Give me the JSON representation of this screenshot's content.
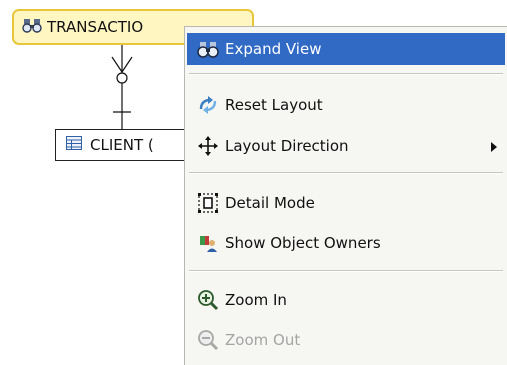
{
  "diagram": {
    "transactions_label": "TRANSACTIO",
    "client_label": "CLIENT ("
  },
  "menu": {
    "items": [
      {
        "label": "Expand View",
        "icon": "binoculars-icon",
        "state": "highlighted"
      },
      {
        "label": "Reset Layout",
        "icon": "refresh-arrows-icon",
        "state": "normal"
      },
      {
        "label": "Layout Direction",
        "icon": "move-arrows-icon",
        "state": "normal",
        "submenu": true
      },
      {
        "label": "Detail Mode",
        "icon": "detail-frame-icon",
        "state": "normal"
      },
      {
        "label": "Show Object Owners",
        "icon": "owner-icon",
        "state": "normal"
      },
      {
        "label": "Zoom In",
        "icon": "zoom-in-icon",
        "state": "normal"
      },
      {
        "label": "Zoom Out",
        "icon": "zoom-out-icon",
        "state": "disabled"
      }
    ]
  },
  "colors": {
    "highlight": "#316ac5",
    "node_border": "#e8c53a",
    "node_fill": "#fff6c2",
    "disabled_text": "#a4a4a4"
  }
}
